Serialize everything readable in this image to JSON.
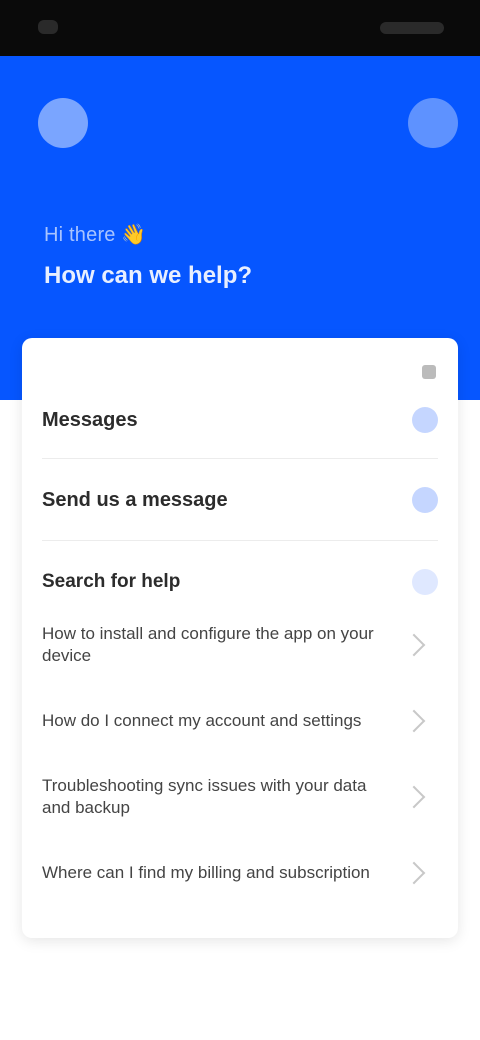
{
  "header": {
    "greeting": "Hi there 👋",
    "headline": "How can we help?"
  },
  "card": {
    "top_label": "",
    "rows": [
      {
        "title": "Messages"
      },
      {
        "title": "Send us a message"
      }
    ],
    "faq_title": "Search for help",
    "faqs": [
      {
        "text": "How to install and configure the app on your device"
      },
      {
        "text": "How do I connect my account and settings"
      },
      {
        "text": "Troubleshooting sync issues with your data and backup"
      },
      {
        "text": "Where can I find my billing and subscription"
      }
    ]
  },
  "colors": {
    "header_blue": "#0656ff",
    "background": "#ffffff"
  }
}
